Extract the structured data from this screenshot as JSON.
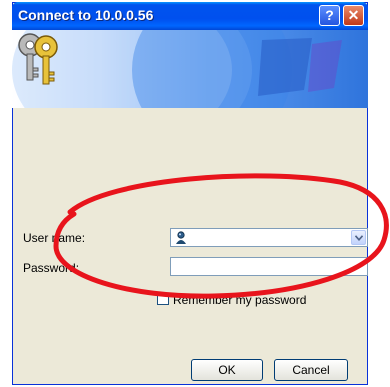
{
  "window": {
    "title": "Connect to 10.0.0.56",
    "help_label": "?",
    "close_label": "✕"
  },
  "form": {
    "username_label": "User name:",
    "password_label": "Password:",
    "remember_label": "Remember my password",
    "username_value": "",
    "password_value": "",
    "remember_checked": false
  },
  "buttons": {
    "ok": "OK",
    "cancel": "Cancel"
  },
  "colors": {
    "annotation": "#e8141c",
    "titlebar": "#0053ee",
    "dialog_bg": "#ece9d8"
  }
}
